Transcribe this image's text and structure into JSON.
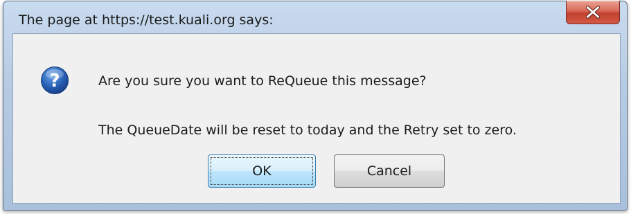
{
  "window": {
    "title": "The page at https://test.kuali.org says:"
  },
  "dialog": {
    "icon": "question-icon",
    "message_line_1": "Are you sure you want to ReQueue this message?",
    "message_line_2": "The QueueDate will be reset to today and the Retry set to zero."
  },
  "buttons": {
    "ok_label": "OK",
    "cancel_label": "Cancel"
  },
  "colors": {
    "close_button": "#c2402f",
    "question_icon": "#2a63b8",
    "client_background": "#f0f0f0",
    "ok_button": "#bee6fd"
  }
}
